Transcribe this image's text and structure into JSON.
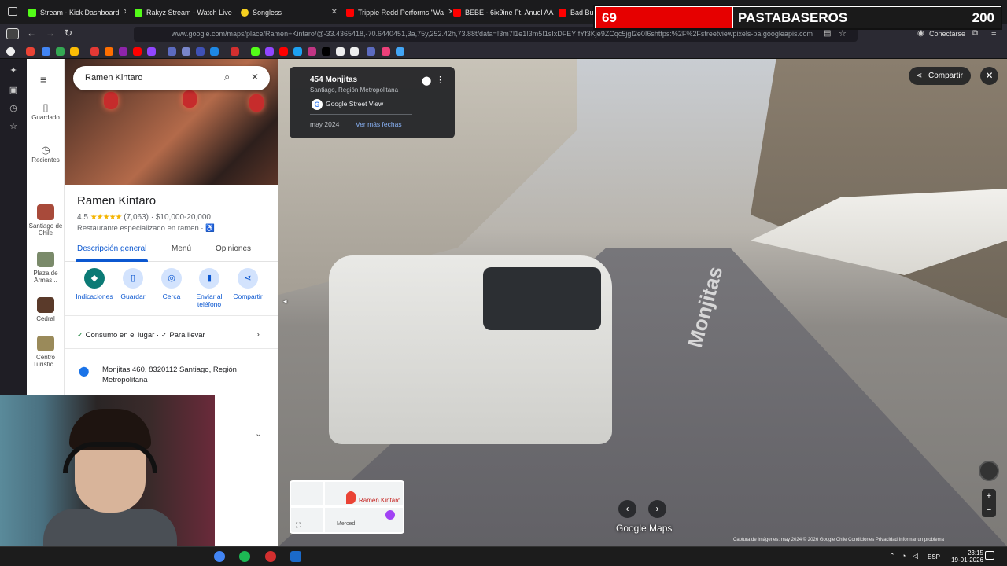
{
  "browser": {
    "tabs": [
      {
        "label": "Stream - Kick Dashboard",
        "color": "#53fc18"
      },
      {
        "label": "Rakyz Stream - Watch Live",
        "color": "#53fc18"
      },
      {
        "label": "Songless",
        "color": "#f5d020"
      },
      {
        "label": "Trippie Redd Performs \"Wa",
        "color": "#ff0000"
      },
      {
        "label": "BEBE - 6ix9ine Ft. Anuel AA",
        "color": "#ff0000"
      },
      {
        "label": "Bad Bun",
        "color": "#ff0000"
      }
    ],
    "url": "www.google.com/maps/place/Ramen+Kintaro/@-33.4365418,-70.6440451,3a,75y,252.42h,73.88t/data=!3m7!1e1!3m5!1sIxDFEYIfYf3Kje9ZCqc5jg!2e0!6shttps:%2F%2Fstreetviewpixels-pa.googleapis.com",
    "connect_label": "Conectarse"
  },
  "maps": {
    "search_query": "Ramen Kintaro",
    "rail": {
      "saved": "Guardado",
      "recent": "Recientes",
      "places": [
        "Santiago de Chile",
        "Plaza de Armas...",
        "Cedral",
        "Centro Turístic..."
      ]
    },
    "place": {
      "name": "Ramen Kintaro",
      "rating": "4.5",
      "stars": "★★★★★",
      "reviews": "(7,063)",
      "price": "$10,000-20,000",
      "category": "Restaurante especializado en ramen",
      "tabs": [
        "Descripción general",
        "Menú",
        "Opiniones"
      ],
      "actions": [
        "Indicaciones",
        "Guardar",
        "Cerca",
        "Enviar al teléfono",
        "Compartir"
      ],
      "services": "Consumo en el lugar · ✓ Para llevar",
      "address": "Monjitas 460, 8320112 Santiago, Región Metropolitana"
    },
    "street_view": {
      "title": "454 Monjitas",
      "subtitle": "Santiago, Región Metropolitana",
      "source": "Google Street View",
      "date": "may 2024",
      "more_dates": "Ver más fechas",
      "share": "Compartir",
      "street_name": "Monjitas",
      "minimap_label": "Ramen Kintaro",
      "minimap_street": "Merced",
      "logo": "Google Maps",
      "footer": "Captura de imágenes: may 2024   © 2026 Google   Chile   Condiciones   Privacidad   Informar un problema"
    }
  },
  "overlay": {
    "left_score": "69",
    "name": "PASTABASEROS",
    "right_score": "200"
  },
  "taskbar": {
    "lang": "ESP",
    "time": "23:15",
    "date": "19-01-2026"
  }
}
